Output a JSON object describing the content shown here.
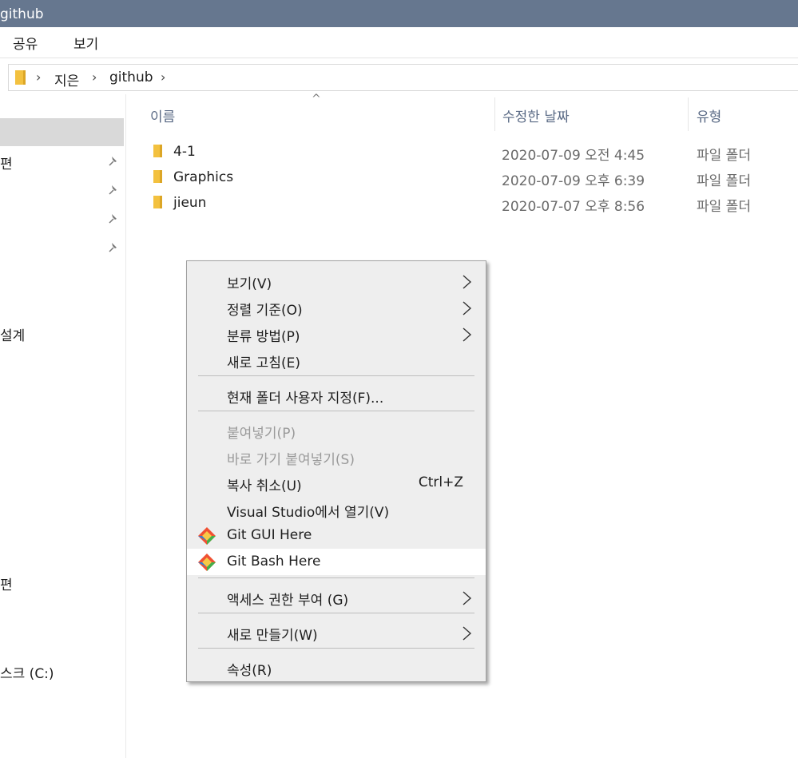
{
  "window": {
    "title": "github"
  },
  "ribbon": {
    "tabs": [
      "공유",
      "보기"
    ]
  },
  "address": {
    "segments": [
      "지은",
      "github"
    ]
  },
  "nav": {
    "items": [
      {
        "label": "편",
        "pinned": true
      },
      {
        "label": "",
        "pinned": true
      },
      {
        "label": "",
        "pinned": true
      },
      {
        "label": "",
        "pinned": true
      },
      {
        "label": "설계"
      },
      {
        "label": "편"
      },
      {
        "label": "스크 (C:)"
      }
    ]
  },
  "columns": {
    "name": "이름",
    "date": "수정한 날짜",
    "type": "유형"
  },
  "files": [
    {
      "name": "4-1",
      "date": "2020-07-09 오전 4:45",
      "type": "파일 폴더"
    },
    {
      "name": "Graphics",
      "date": "2020-07-09 오후 6:39",
      "type": "파일 폴더"
    },
    {
      "name": "jieun",
      "date": "2020-07-07 오후 8:56",
      "type": "파일 폴더"
    }
  ],
  "context_menu": {
    "items": [
      {
        "label": "보기(V)",
        "submenu": true
      },
      {
        "label": "정렬 기준(O)",
        "submenu": true
      },
      {
        "label": "분류 방법(P)",
        "submenu": true
      },
      {
        "label": "새로 고침(E)"
      },
      {
        "label": "현재 폴더 사용자 지정(F)..."
      },
      {
        "label": "붙여넣기(P)",
        "disabled": true
      },
      {
        "label": "바로 가기 붙여넣기(S)",
        "disabled": true
      },
      {
        "label": "복사 취소(U)",
        "shortcut": "Ctrl+Z"
      },
      {
        "label": "Visual Studio에서 열기(V)"
      },
      {
        "label": "Git GUI Here",
        "icon": "git-icon"
      },
      {
        "label": "Git Bash Here",
        "icon": "git-icon",
        "highlighted": true
      },
      {
        "label": "액세스 권한 부여 (G)",
        "submenu": true
      },
      {
        "label": "새로 만들기(W)",
        "submenu": true
      },
      {
        "label": "속성(R)"
      }
    ]
  },
  "colors": {
    "titlebar": "#66778f",
    "folder": "#f3c13f",
    "menu_bg": "#eeeeee",
    "highlight": "#ffffff"
  }
}
